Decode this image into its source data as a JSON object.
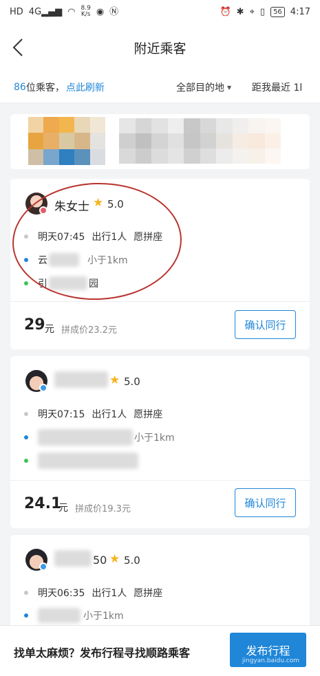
{
  "status_bar": {
    "left_icons": [
      "HD",
      "4G",
      "wifi-icon",
      "8.9 K/s",
      "eye-icon",
      "nfc-icon"
    ],
    "net_speed": "8.9\nK/s",
    "right_icons": [
      "alarm-icon",
      "bluetooth-icon",
      "location-icon",
      "vibrate-icon"
    ],
    "battery": "56",
    "time": "4:17"
  },
  "nav": {
    "title": "附近乘客"
  },
  "filter": {
    "count": "86",
    "count_suffix": "位乘客，",
    "refresh": "点此刷新",
    "destination": "全部目的地",
    "distance": "距我最近 1l"
  },
  "cards": [
    {
      "name": "朱女士",
      "rating": "5.0",
      "time": "明天07:45",
      "people": "出行1人",
      "carpool": "愿拼座",
      "start_prefix": "云",
      "start_distance": "小于1km",
      "end_prefix": "引",
      "end_suffix": "园",
      "price": "29",
      "unit": "元",
      "pool_price": "拼成价23.2元",
      "confirm": "确认同行"
    },
    {
      "name": "",
      "rating": "5.0",
      "time": "明天07:15",
      "people": "出行1人",
      "carpool": "愿拼座",
      "start_distance": "小于1km",
      "price": "24.1",
      "unit": "元",
      "pool_price": "拼成价19.3元",
      "confirm": "确认同行"
    },
    {
      "name_suffix": "50",
      "rating": "5.0",
      "time": "明天06:35",
      "people": "出行1人",
      "carpool": "愿拼座",
      "start_distance": "小于1km"
    }
  ],
  "bottom": {
    "prompt": "找单太麻烦？发布行程寻找顺路乘客",
    "publish": "发布行程",
    "watermark": "jingyan.baidu.com"
  },
  "colors": {
    "accent": "#1f86d8",
    "star": "#f5b41e",
    "ring": "#b8342e"
  }
}
